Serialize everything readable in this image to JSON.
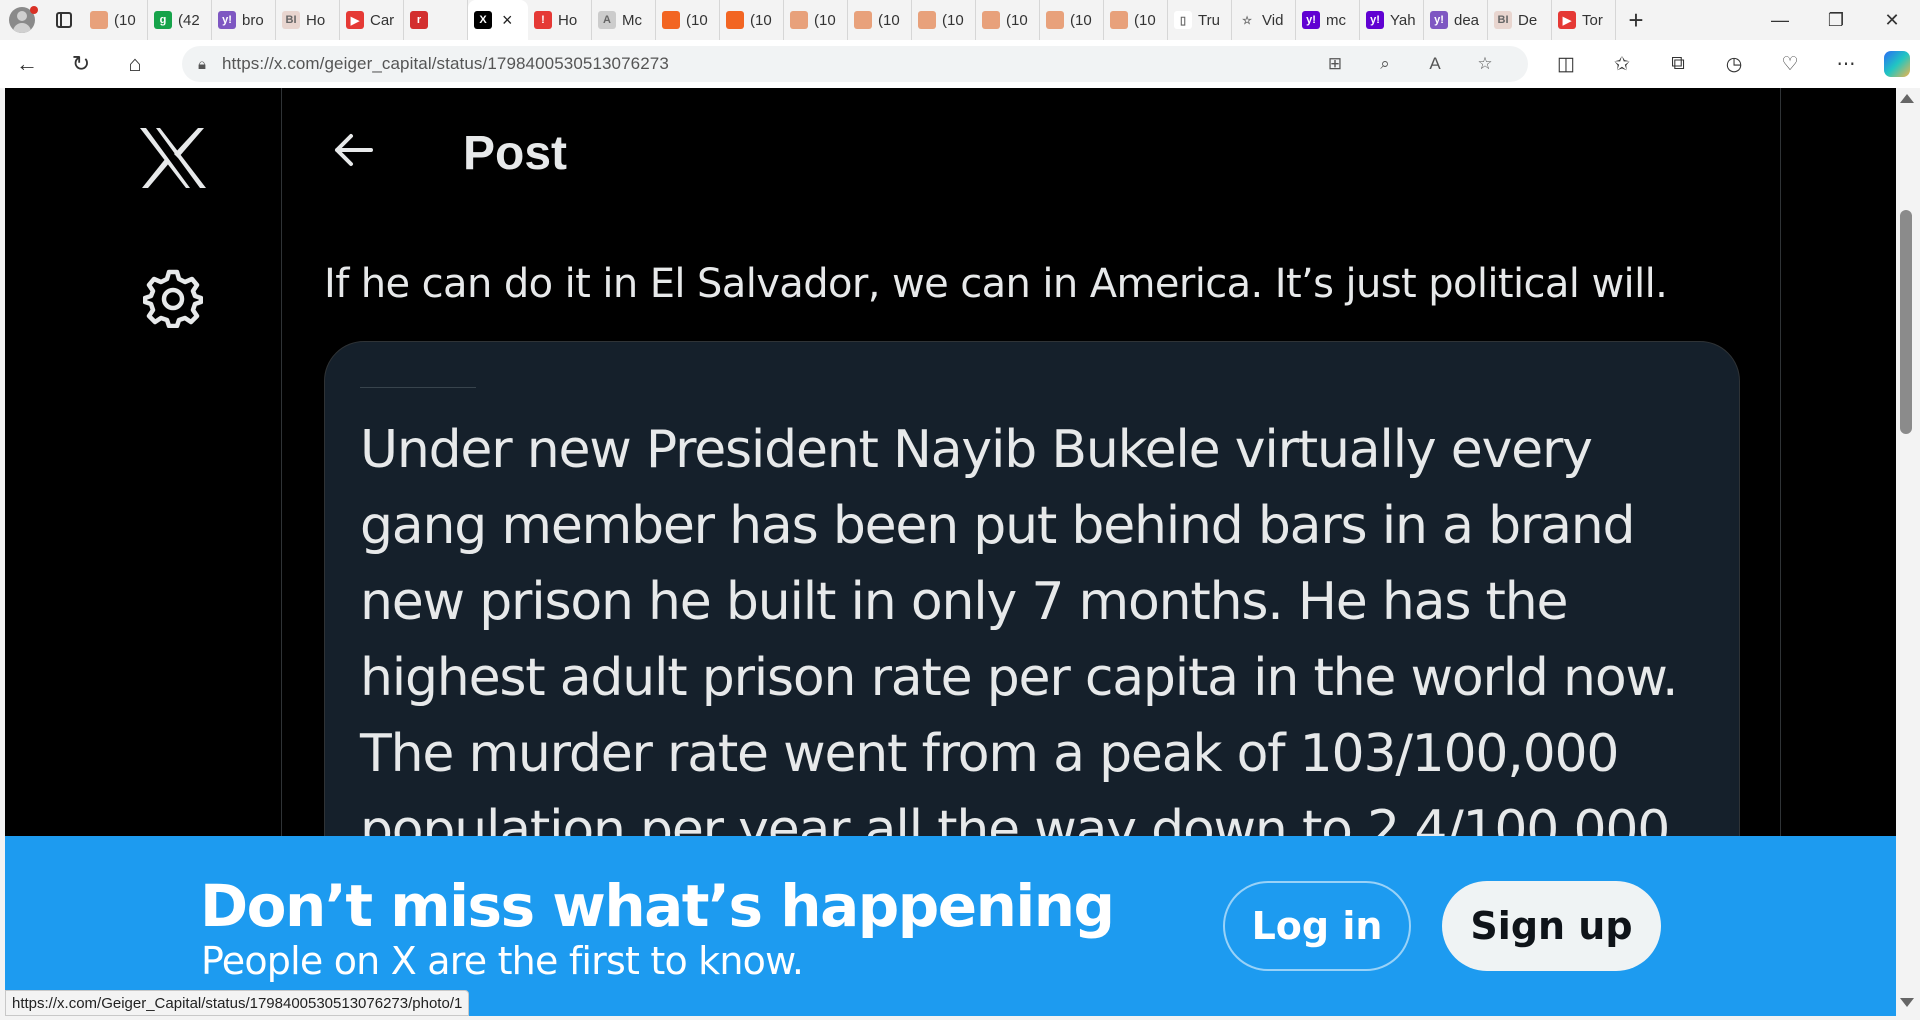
{
  "browser": {
    "tabs": [
      {
        "label": "(10",
        "color": "#e8a17b",
        "glyph": ""
      },
      {
        "label": "(42",
        "color": "#16a34a",
        "glyph": "g"
      },
      {
        "label": "bro",
        "color": "#7e57c2",
        "glyph": "y!"
      },
      {
        "label": "Ho",
        "color": "#e8d5cf",
        "glyph": "BI"
      },
      {
        "label": "Car",
        "color": "#e53935",
        "glyph": "▶"
      },
      {
        "label": "",
        "color": "#d32f2f",
        "glyph": "r"
      },
      {
        "label": "",
        "color": "#000000",
        "glyph": "X",
        "active": true
      },
      {
        "label": "Ho",
        "color": "#e53935",
        "glyph": "!"
      },
      {
        "label": "Mc",
        "color": "#cccccc",
        "glyph": "A"
      },
      {
        "label": "(10",
        "color": "#f26522",
        "glyph": ""
      },
      {
        "label": "(10",
        "color": "#f26522",
        "glyph": ""
      },
      {
        "label": "(10",
        "color": "#e8a17b",
        "glyph": ""
      },
      {
        "label": "(10",
        "color": "#e8a17b",
        "glyph": ""
      },
      {
        "label": "(10",
        "color": "#e8a17b",
        "glyph": ""
      },
      {
        "label": "(10",
        "color": "#e8a17b",
        "glyph": ""
      },
      {
        "label": "(10",
        "color": "#e8a17b",
        "glyph": ""
      },
      {
        "label": "(10",
        "color": "#e8a17b",
        "glyph": ""
      },
      {
        "label": "Tru",
        "color": "#ffffff",
        "glyph": "▯"
      },
      {
        "label": "Vid",
        "color": "#f3f3f3",
        "glyph": "☆"
      },
      {
        "label": "mc",
        "color": "#6001d2",
        "glyph": "y!"
      },
      {
        "label": "Yah",
        "color": "#6001d2",
        "glyph": "y!"
      },
      {
        "label": "dea",
        "color": "#7e57c2",
        "glyph": "y!"
      },
      {
        "label": "De",
        "color": "#e8d5cf",
        "glyph": "BI"
      },
      {
        "label": "Tor",
        "color": "#e53935",
        "glyph": "▶"
      }
    ],
    "url": "https://x.com/geiger_capital/status/1798400530513076273",
    "status_url": "https://x.com/Geiger_Capital/status/1798400530513076273/photo/1"
  },
  "header": {
    "title": "Post"
  },
  "post": {
    "text": "If he can do it in El Salvador, we can in America. It’s just political will.",
    "quote_text": "Under new President Nayib Bukele virtually every gang member has been put behind bars in a brand new prison he built in only 7 months. He has the highest adult prison rate per capita in the world now. The murder rate went from a peak of 103/100,000 population per year all the way down to 2.4/100,000"
  },
  "banner": {
    "headline": "Don’t miss what’s happening",
    "subtext": "People on X are the first to know.",
    "login_label": "Log in",
    "signup_label": "Sign up"
  },
  "colors": {
    "banner_bg": "#1d9bf0",
    "page_bg": "#000000",
    "card_bg": "#15202b"
  }
}
